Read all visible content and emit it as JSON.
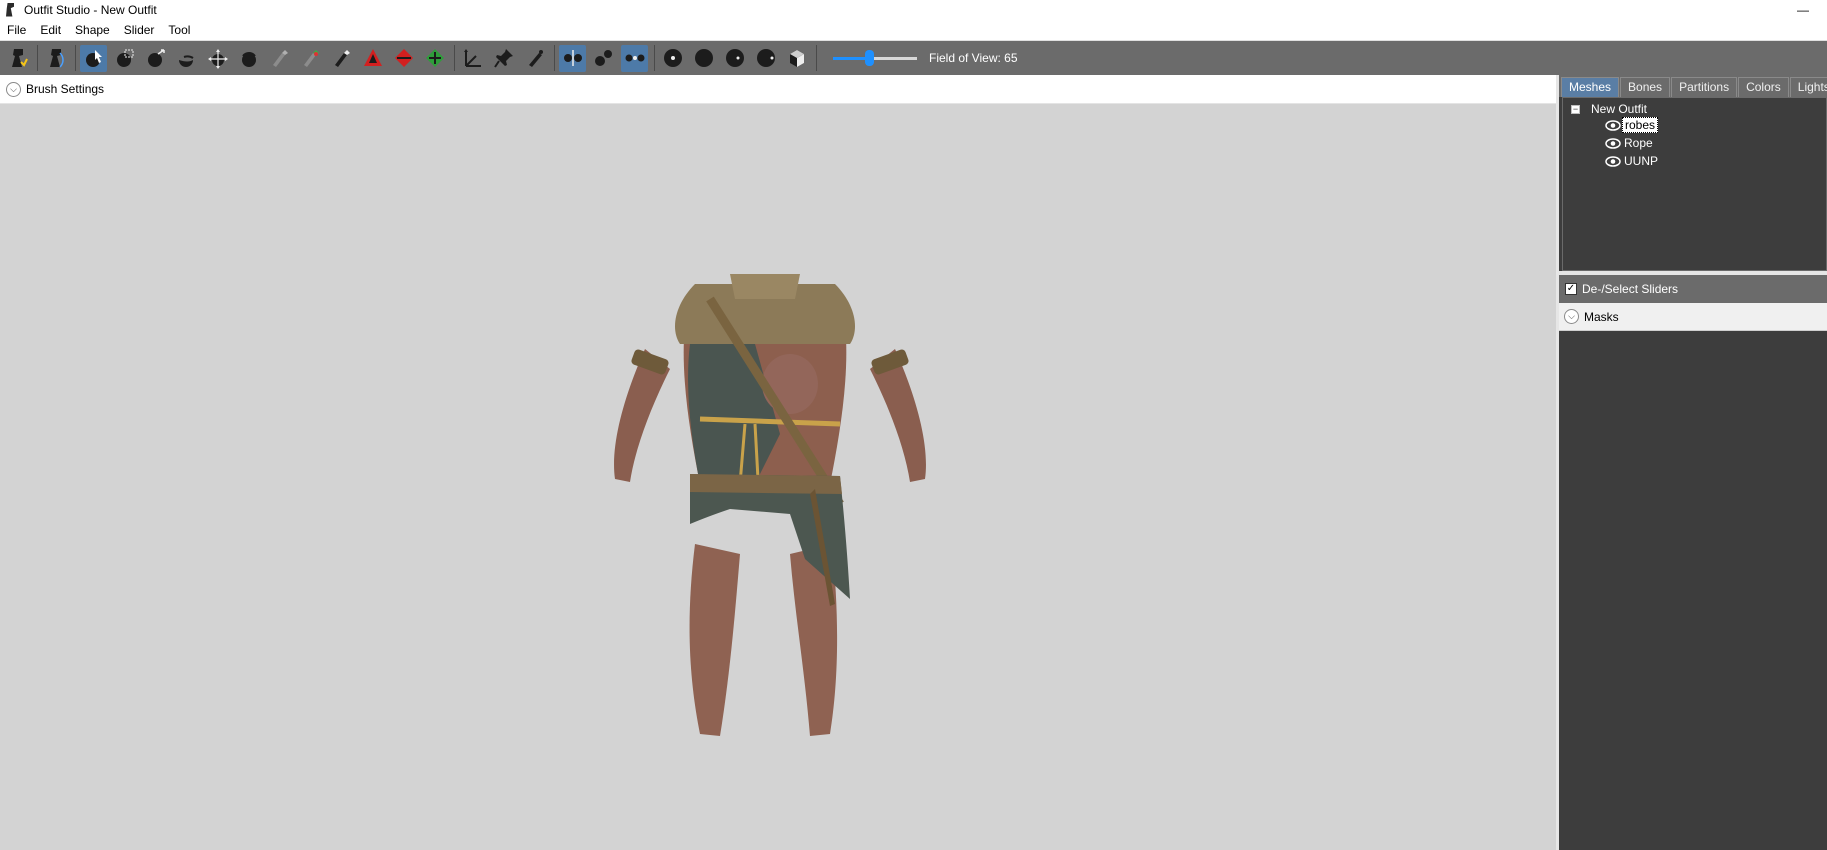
{
  "window": {
    "title": "Outfit Studio - New Outfit",
    "minimize_glyph": "—"
  },
  "menu": {
    "items": [
      "File",
      "Edit",
      "Shape",
      "Slider",
      "Tool"
    ]
  },
  "toolbar": {
    "fov_label": "Field of View: 65",
    "fov_value": 65,
    "fov_slider_fraction": 0.42,
    "accent_color": "#4d7aa8",
    "slider_color": "#1e90ff"
  },
  "viewport": {
    "brush_settings_label": "Brush Settings",
    "collapse_glyph": "⌵",
    "background_color": "#d3d3d3"
  },
  "right_panel": {
    "tabs": [
      "Meshes",
      "Bones",
      "Partitions",
      "Colors",
      "Lights"
    ],
    "active_tab": "Meshes",
    "tree": {
      "root_label": "New Outfit",
      "toggle_glyph": "−",
      "items": [
        {
          "label": "robes",
          "selected": true
        },
        {
          "label": "Rope",
          "selected": false
        },
        {
          "label": "UUNP",
          "selected": false
        }
      ]
    },
    "deselect_sliders_label": "De-/Select Sliders",
    "deselect_checked_glyph": "✓",
    "masks_label": "Masks"
  }
}
